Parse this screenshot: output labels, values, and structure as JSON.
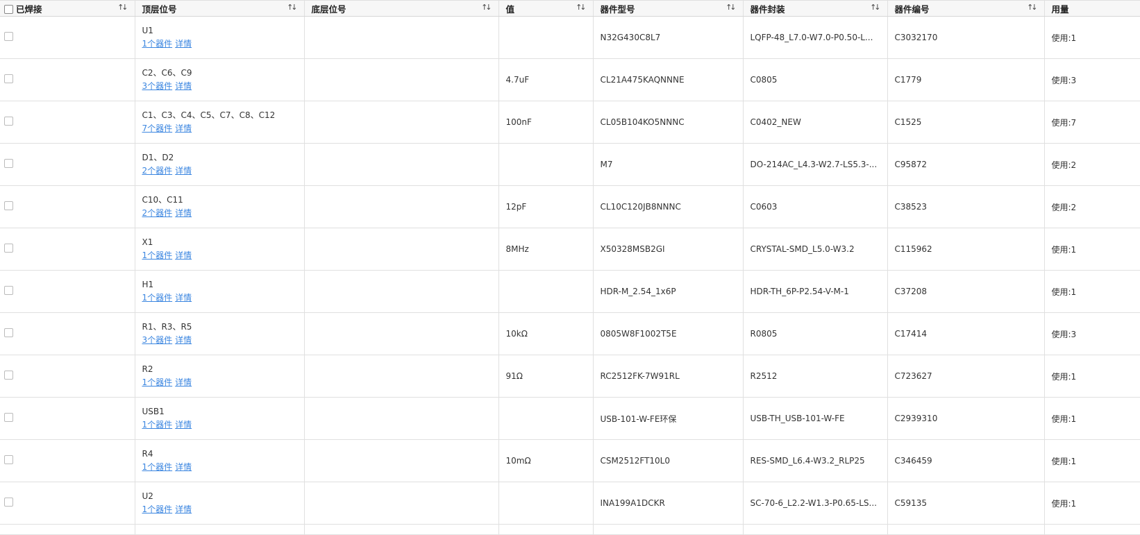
{
  "columns": [
    {
      "key": "soldered",
      "label": "已焊接",
      "sortable": true
    },
    {
      "key": "top",
      "label": "顶层位号",
      "sortable": true
    },
    {
      "key": "bottom",
      "label": "底层位号",
      "sortable": true
    },
    {
      "key": "value",
      "label": "值",
      "sortable": true
    },
    {
      "key": "model",
      "label": "器件型号",
      "sortable": true
    },
    {
      "key": "package",
      "label": "器件封装",
      "sortable": true
    },
    {
      "key": "code",
      "label": "器件编号",
      "sortable": true
    },
    {
      "key": "usage",
      "label": "用量",
      "sortable": false
    }
  ],
  "icons": {
    "sort": "sort-arrows-icon",
    "checkbox": "checkbox-icon"
  },
  "colors": {
    "link": "#3b86e0",
    "header_bg": "#f7f7f7",
    "border": "#e0e0e0"
  },
  "detail_label": "详情",
  "rows": [
    {
      "top": "U1",
      "count_link": "1个器件",
      "bottom": "",
      "value": "",
      "model": "N32G430C8L7",
      "package": "LQFP-48_L7.0-W7.0-P0.50-L...",
      "code": "C3032170",
      "usage": "使用:1"
    },
    {
      "top": "C2、C6、C9",
      "count_link": "3个器件",
      "bottom": "",
      "value": "4.7uF",
      "model": "CL21A475KAQNNNE",
      "package": "C0805",
      "code": "C1779",
      "usage": "使用:3"
    },
    {
      "top": "C1、C3、C4、C5、C7、C8、C12",
      "count_link": "7个器件",
      "bottom": "",
      "value": "100nF",
      "model": "CL05B104KO5NNNC",
      "package": "C0402_NEW",
      "code": "C1525",
      "usage": "使用:7"
    },
    {
      "top": "D1、D2",
      "count_link": "2个器件",
      "bottom": "",
      "value": "",
      "model": "M7",
      "package": "DO-214AC_L4.3-W2.7-LS5.3-...",
      "code": "C95872",
      "usage": "使用:2"
    },
    {
      "top": "C10、C11",
      "count_link": "2个器件",
      "bottom": "",
      "value": "12pF",
      "model": "CL10C120JB8NNNC",
      "package": "C0603",
      "code": "C38523",
      "usage": "使用:2"
    },
    {
      "top": "X1",
      "count_link": "1个器件",
      "bottom": "",
      "value": "8MHz",
      "model": "X50328MSB2GI",
      "package": "CRYSTAL-SMD_L5.0-W3.2",
      "code": "C115962",
      "usage": "使用:1"
    },
    {
      "top": "H1",
      "count_link": "1个器件",
      "bottom": "",
      "value": "",
      "model": "HDR-M_2.54_1x6P",
      "package": "HDR-TH_6P-P2.54-V-M-1",
      "code": "C37208",
      "usage": "使用:1"
    },
    {
      "top": "R1、R3、R5",
      "count_link": "3个器件",
      "bottom": "",
      "value": "10kΩ",
      "model": "0805W8F1002T5E",
      "package": "R0805",
      "code": "C17414",
      "usage": "使用:3"
    },
    {
      "top": "R2",
      "count_link": "1个器件",
      "bottom": "",
      "value": "91Ω",
      "model": "RC2512FK-7W91RL",
      "package": "R2512",
      "code": "C723627",
      "usage": "使用:1"
    },
    {
      "top": "USB1",
      "count_link": "1个器件",
      "bottom": "",
      "value": "",
      "model": "USB-101-W-FE环保",
      "package": "USB-TH_USB-101-W-FE",
      "code": "C2939310",
      "usage": "使用:1"
    },
    {
      "top": "R4",
      "count_link": "1个器件",
      "bottom": "",
      "value": "10mΩ",
      "model": "CSM2512FT10L0",
      "package": "RES-SMD_L6.4-W3.2_RLP25",
      "code": "C346459",
      "usage": "使用:1"
    },
    {
      "top": "U2",
      "count_link": "1个器件",
      "bottom": "",
      "value": "",
      "model": "INA199A1DCKR",
      "package": "SC-70-6_L2.2-W1.3-P0.65-LS...",
      "code": "C59135",
      "usage": "使用:1"
    }
  ]
}
